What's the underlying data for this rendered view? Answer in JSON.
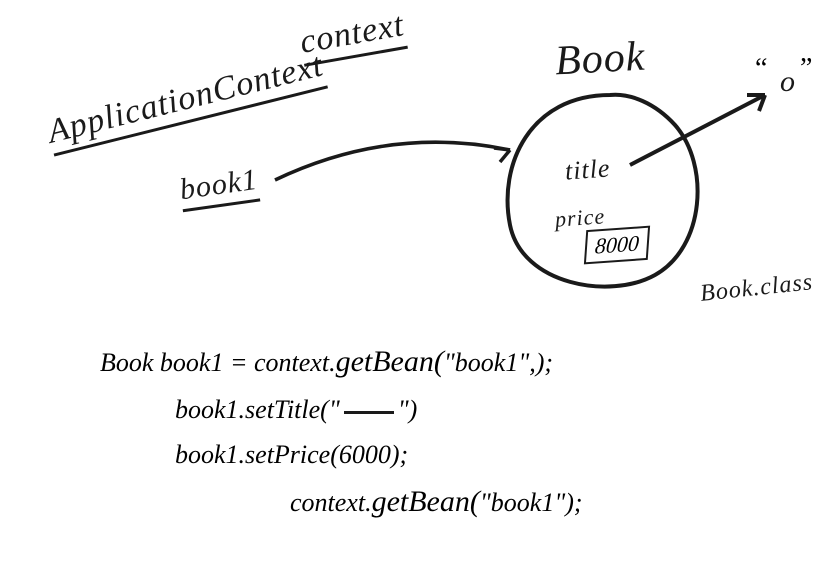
{
  "labels": {
    "application_context": "ApplicationContext",
    "context": "context",
    "book1": "book1",
    "book_class_heading": "Book",
    "title_field": "title",
    "price_field": "price",
    "price_value": "8000",
    "book_class_anno": "Book.class",
    "title_pointer_value": "o"
  },
  "code": {
    "line1_prefix": "Book book1 = context.",
    "line1_method": "getBean(",
    "line1_arg": "\"book1\",",
    "line1_close": ");",
    "line2": "book1.setTitle(\"",
    "line2_close": "\")",
    "line3": "book1.setPrice(6000);",
    "line4_prefix": "context.",
    "line4_method": "getBean(",
    "line4_arg": "\"book1\"",
    "line4_close": ");"
  }
}
